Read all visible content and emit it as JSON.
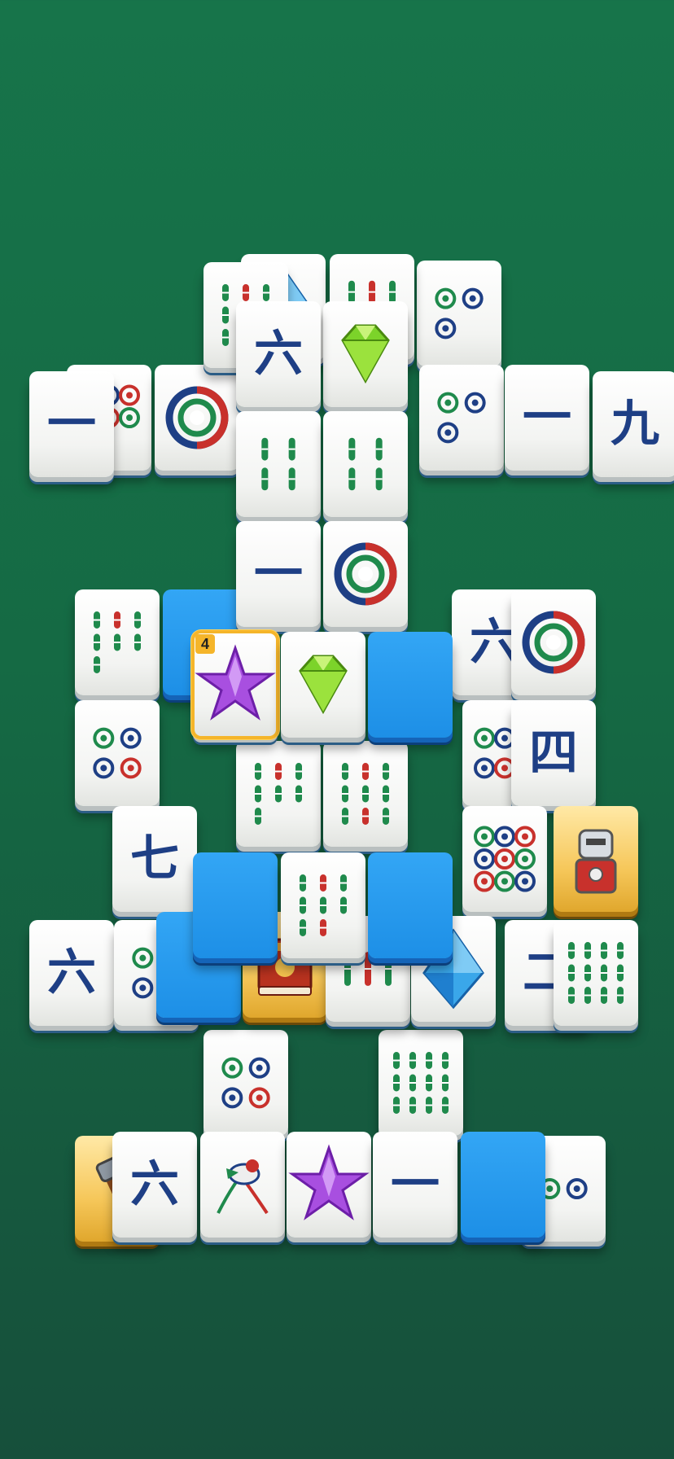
{
  "board": {
    "colors": {
      "background_top": "#17744a",
      "background_bottom": "#164f3b",
      "blank_tile": "#1d8fe6",
      "highlight": "#f5b52a",
      "character_ink": "#1e3f85",
      "bamboo_green": "#1f8a4c",
      "bamboo_red": "#c8312c"
    },
    "tiles": [
      {
        "icon": "char-one-tile",
        "face": "char",
        "label": "一",
        "blocked": true
      },
      {
        "icon": "diamond-gem-tile",
        "face": "diamond"
      },
      {
        "icon": "bamboo-tile",
        "face": "bamboo",
        "count": 6
      },
      {
        "icon": "circles-tile",
        "face": "circles",
        "count": 3
      },
      {
        "icon": "bamboo-tile",
        "face": "bamboo",
        "count": 8
      },
      {
        "icon": "green-gem-tile",
        "face": "gem"
      },
      {
        "icon": "char-six-tile",
        "face": "char",
        "label": "六"
      },
      {
        "icon": "circles-tile",
        "face": "circles",
        "count": 7
      },
      {
        "icon": "circle-one-tile",
        "face": "circle1"
      },
      {
        "icon": "circles-tile",
        "face": "circles",
        "count": 3
      },
      {
        "icon": "char-one-tile",
        "face": "char",
        "label": "一"
      },
      {
        "icon": "char-nine-tile",
        "face": "char",
        "label": "九"
      },
      {
        "icon": "bamboo-tile",
        "face": "bamboo",
        "count": 4
      },
      {
        "icon": "bamboo-tile",
        "face": "bamboo",
        "count": 4
      },
      {
        "icon": "char-one-tile",
        "face": "char",
        "label": "一"
      },
      {
        "icon": "circle-one-tile",
        "face": "circle1"
      },
      {
        "icon": "bamboo-tile",
        "face": "bamboo",
        "count": 7
      },
      {
        "icon": "blank-tile",
        "face": "blank"
      },
      {
        "icon": "star-tile",
        "face": "star",
        "badge": "4"
      },
      {
        "icon": "green-gem-tile",
        "face": "gem"
      },
      {
        "icon": "blank-tile",
        "face": "blank"
      },
      {
        "icon": "char-six-tile",
        "face": "char",
        "label": "六"
      },
      {
        "icon": "circle-one-tile",
        "face": "circle1"
      },
      {
        "icon": "circles-tile",
        "face": "circles",
        "count": 4
      },
      {
        "icon": "circles-tile",
        "face": "circles",
        "count": 5
      },
      {
        "icon": "char-four-tile",
        "face": "char",
        "label": "四"
      },
      {
        "icon": "bamboo-tile",
        "face": "bamboo",
        "count": 7
      },
      {
        "icon": "bamboo-tile",
        "face": "bamboo",
        "count": 9
      },
      {
        "icon": "char-seven-tile",
        "face": "char",
        "label": "七"
      },
      {
        "icon": "circles-tile",
        "face": "circles",
        "count": 9
      },
      {
        "icon": "robot-knight-tile",
        "face": "robot"
      },
      {
        "icon": "blank-tile",
        "face": "blank"
      },
      {
        "icon": "bamboo-tile",
        "face": "bamboo",
        "count": 8
      },
      {
        "icon": "blank-tile",
        "face": "blank"
      },
      {
        "icon": "char-six-tile",
        "face": "char",
        "label": "六"
      },
      {
        "icon": "circles-tile",
        "face": "circles",
        "count": 3
      },
      {
        "icon": "blank-tile",
        "face": "blank"
      },
      {
        "icon": "book-tile",
        "face": "book"
      },
      {
        "icon": "bamboo-tile",
        "face": "bamboo",
        "count": 3
      },
      {
        "icon": "blue-diamond-tile",
        "face": "diamond"
      },
      {
        "icon": "char-two-tile",
        "face": "char",
        "label": "二"
      },
      {
        "icon": "bamboo-tile",
        "face": "bamboo",
        "count": 12
      },
      {
        "icon": "circles-tile",
        "face": "circles",
        "count": 4
      },
      {
        "icon": "bamboo-tile",
        "face": "bamboo",
        "count": 12
      },
      {
        "icon": "hammer-tile",
        "face": "hammer"
      },
      {
        "icon": "char-six-tile",
        "face": "char",
        "label": "六"
      },
      {
        "icon": "bird-tile",
        "face": "bird"
      },
      {
        "icon": "star-tile",
        "face": "star"
      },
      {
        "icon": "char-one-tile",
        "face": "char",
        "label": "一"
      },
      {
        "icon": "blank-tile",
        "face": "blank"
      },
      {
        "icon": "circles-tile",
        "face": "circles",
        "count": 2
      }
    ]
  }
}
